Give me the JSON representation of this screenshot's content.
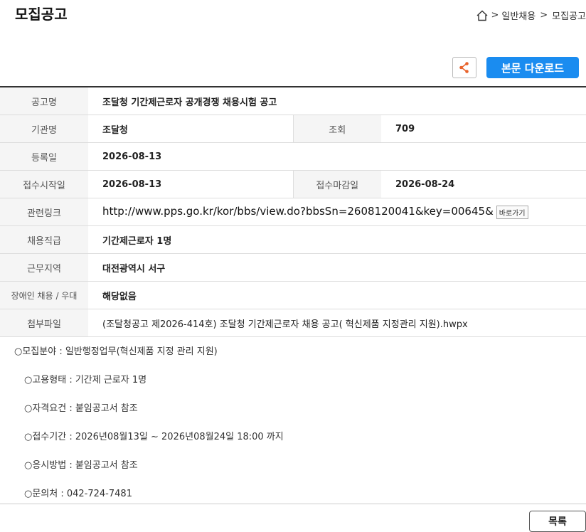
{
  "page_title": "모집공고",
  "breadcrumb": {
    "sep": ">",
    "item1": "일반채용",
    "item2": "모집공고"
  },
  "actions": {
    "download_label": "본문 다운로드",
    "list_label": "목록"
  },
  "info": {
    "notice_name_label": "공고명",
    "notice_name": "조달청 기간제근로자 공개경쟁 채용시험 공고",
    "agency_label": "기관명",
    "agency": "조달청",
    "views_label": "조회",
    "views": "709",
    "reg_date_label": "등록일",
    "reg_date": "2026-08-13",
    "start_label": "접수시작일",
    "start_date": "2026-08-13",
    "end_label": "접수마감일",
    "end_date": "2026-08-24",
    "link_label": "관련링크",
    "link_url": "http://www.pps.go.kr/kor/bbs/view.do?bbsSn=2608120041&key=00645&",
    "link_button": "바로가기",
    "position_label": "채용직급",
    "position": "기간제근로자 1명",
    "location_label": "근무지역",
    "location": "대전광역시 서구",
    "disability_label": "장애인 채용 / 우대",
    "disability": "해당없음",
    "attachment_label": "첨부파일",
    "attachment": "(조달청공고 제2026-414호) 조달청 기간제근로자 채용 공고( 혁신제품 지정관리 지원).hwpx"
  },
  "body_lines": [
    "○모집분야 : 일반행정업무(혁신제품 지정 관리 지원)",
    "○고용형태 : 기간제 근로자  1명",
    "○자격요건 : 붙임공고서 참조",
    "○접수기간 : 2026년08월13일 ~ 2026년08월24일 18:00 까지",
    "○응시방법 : 붙임공고서 참조",
    "○문의처 : 042-724-7481"
  ]
}
